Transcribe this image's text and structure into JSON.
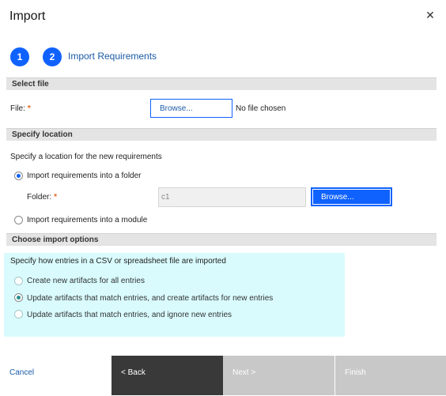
{
  "dialog": {
    "title": "Import",
    "close_glyph": "✕"
  },
  "steps": [
    {
      "number": "1"
    },
    {
      "number": "2",
      "label": "Import Requirements"
    }
  ],
  "select_file": {
    "header": "Select file",
    "file_label": "File:",
    "required_mark": "*",
    "browse_label": "Browse...",
    "status": "No file chosen"
  },
  "location": {
    "header": "Specify location",
    "description": "Specify a location for the new requirements",
    "option_folder": "Import requirements into a folder",
    "folder_label": "Folder:",
    "required_mark": "*",
    "folder_value": "c1",
    "browse_label": "Browse...",
    "option_module": "Import requirements into a module"
  },
  "options": {
    "header": "Choose import options",
    "description": "Specify how entries in a CSV or spreadsheet file are imported",
    "items": [
      "Create new artifacts for all entries",
      "Update artifacts that match entries, and create artifacts for new entries",
      "Update artifacts that match entries, and ignore new entries"
    ]
  },
  "footer": {
    "cancel": "Cancel",
    "back": "< Back",
    "next": "Next >",
    "finish": "Finish"
  },
  "colors": {
    "accent": "#0f62fe",
    "highlight": "#d9fbfd",
    "back_button": "#393939",
    "disabled": "#c8c8c8"
  }
}
